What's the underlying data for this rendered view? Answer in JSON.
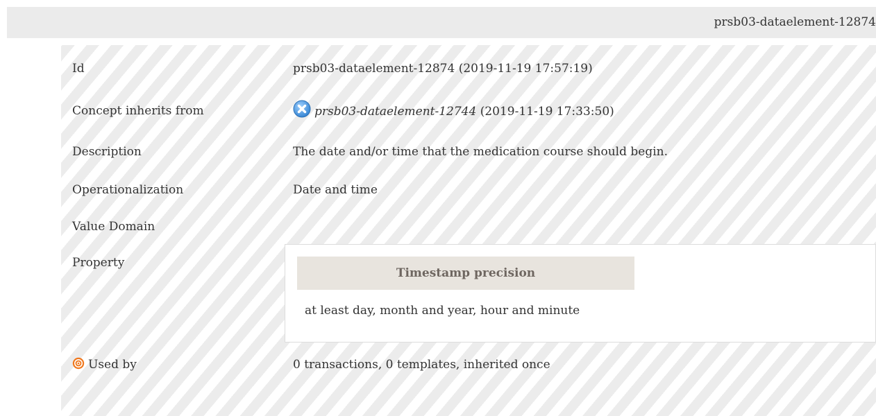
{
  "header": {
    "id_text": "prsb03-dataelement-12874"
  },
  "rows": {
    "id": {
      "label": "Id",
      "value": "prsb03-dataelement-12874 (2019-11-19 17:57:19)"
    },
    "concept": {
      "label": "Concept inherits from",
      "link": "prsb03-dataelement-12744",
      "date": " (2019-11-19 17:33:50)",
      "icon": "close-circle-icon"
    },
    "description": {
      "label": "Description",
      "value": "The date and/or time that the medication course should begin."
    },
    "operationalization": {
      "label": "Operationalization",
      "value": "Date and time"
    },
    "value_domain": {
      "label": "Value Domain"
    },
    "property": {
      "label": "Property",
      "header": "Timestamp precision",
      "value": "at least day, month and year, hour and minute"
    },
    "used_by": {
      "label": "Used by",
      "value": "0 transactions, 0 templates, inherited once",
      "icon": "target-icon"
    }
  },
  "colors": {
    "header_bg": "#ebebeb",
    "stripe_light": "#ffffff",
    "stripe_dark": "#ececec",
    "property_header_bg": "#e8e4de",
    "property_header_text": "#6e6660",
    "concept_icon": "#3f8fd6",
    "usedby_icon": "#f0781e"
  }
}
